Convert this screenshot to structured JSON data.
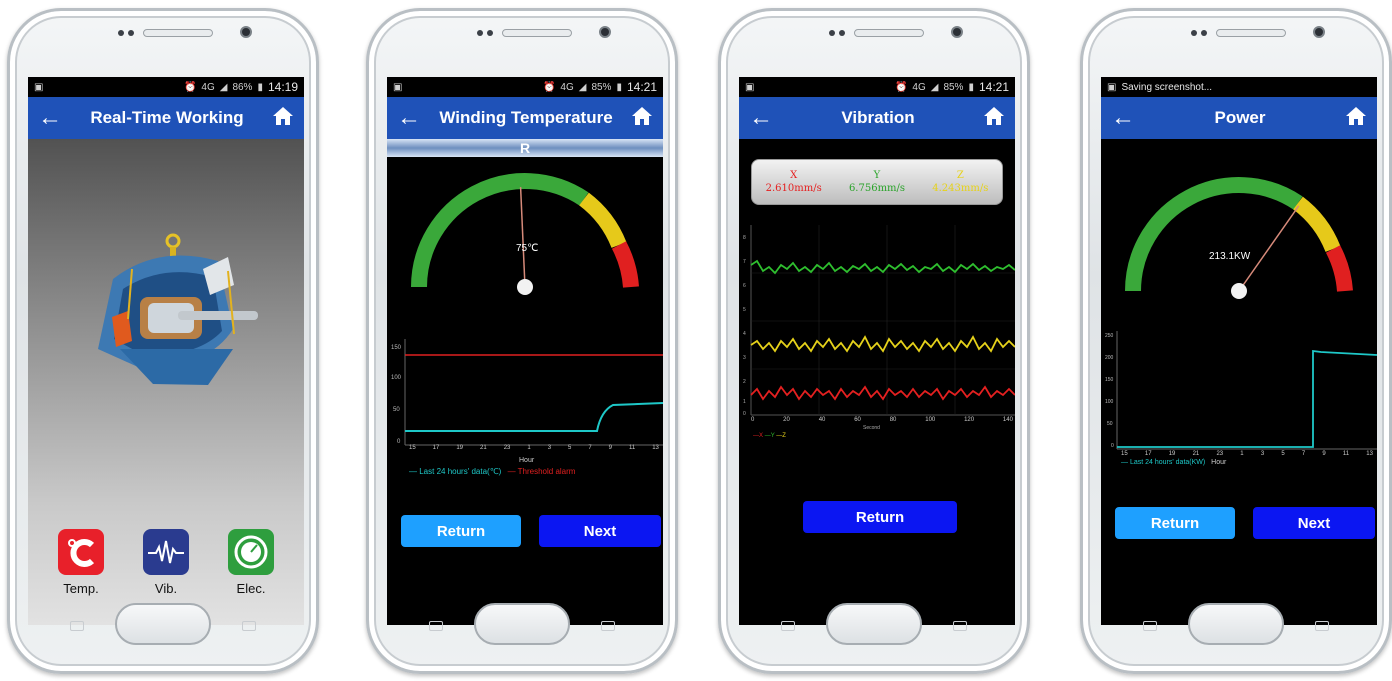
{
  "phones": [
    {
      "status": {
        "battery": "86%",
        "time": "14:19",
        "network": "4G"
      },
      "title": "Real-Time Working",
      "tiles": [
        {
          "label": "Temp.",
          "icon": "celsius-icon",
          "color": "#e8202a"
        },
        {
          "label": "Vib.",
          "icon": "pulse-icon",
          "color": "#2a3b8f"
        },
        {
          "label": "Elec.",
          "icon": "gauge-icon",
          "color": "#2e9e3e"
        }
      ]
    },
    {
      "status": {
        "battery": "85%",
        "time": "14:21",
        "network": "4G"
      },
      "title": "Winding Temperature",
      "phase": "R",
      "gauge_value": "75℃",
      "gauge_needle_fraction": 0.35,
      "y_ticks": [
        "150",
        "100",
        "50",
        "0"
      ],
      "x_ticks": [
        "15",
        "17",
        "19",
        "21",
        "23",
        "1",
        "3",
        "5",
        "7",
        "9",
        "11",
        "13"
      ],
      "x_label": "Hour",
      "legend_data": "Last 24 hours' data(℃)",
      "legend_alarm": "Threshold alarm",
      "return_label": "Return",
      "next_label": "Next"
    },
    {
      "status": {
        "battery": "85%",
        "time": "14:21",
        "network": "4G"
      },
      "title": "Vibration",
      "axes": [
        {
          "name": "X",
          "value": "2.610mm/s",
          "color": "#e52020"
        },
        {
          "name": "Y",
          "value": "6.756mm/s",
          "color": "#29a329"
        },
        {
          "name": "Z",
          "value": "4.243mm/s",
          "color": "#e6d21a"
        }
      ],
      "y_ticks": [
        "8",
        "7",
        "6",
        "5",
        "4",
        "3",
        "2",
        "1",
        "0"
      ],
      "x_ticks": [
        "0",
        "20",
        "40",
        "60",
        "80",
        "100",
        "120",
        "140"
      ],
      "x_label": "Second",
      "legend": [
        "X",
        "Y",
        "Z"
      ],
      "return_label": "Return"
    },
    {
      "status": {
        "notification": "Saving screenshot..."
      },
      "title": "Power",
      "gauge_value": "213.1KW",
      "gauge_needle_fraction": 0.53,
      "y_ticks": [
        "250",
        "200",
        "150",
        "100",
        "50",
        "0"
      ],
      "x_ticks": [
        "15",
        "17",
        "19",
        "21",
        "23",
        "1",
        "3",
        "5",
        "7",
        "9",
        "11",
        "13"
      ],
      "x_label": "Hour",
      "legend_data": "Last 24 hours' data(KW)",
      "return_label": "Return",
      "next_label": "Next"
    }
  ]
}
